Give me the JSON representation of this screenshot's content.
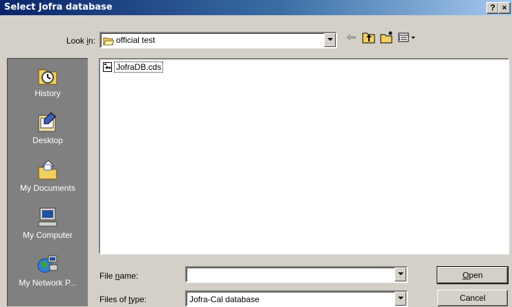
{
  "window": {
    "title": "Select Jofra database",
    "help_label": "?",
    "close_label": "×"
  },
  "lookin": {
    "label_pre": "Look ",
    "label_key": "i",
    "label_post": "n:",
    "value": "official test"
  },
  "toolbar": {
    "back_icon": "back-arrow-icon",
    "up_icon": "up-folder-icon",
    "new_folder_icon": "new-folder-icon",
    "view_icon": "view-menu-icon"
  },
  "places": [
    {
      "label": "History",
      "icon": "history-icon"
    },
    {
      "label": "Desktop",
      "icon": "desktop-icon"
    },
    {
      "label": "My Documents",
      "icon": "my-documents-icon"
    },
    {
      "label": "My Computer",
      "icon": "my-computer-icon"
    },
    {
      "label": "My Network P...",
      "icon": "network-places-icon"
    }
  ],
  "files": [
    {
      "name": "JofraDB.cds",
      "icon": "database-file-icon"
    }
  ],
  "filename": {
    "label_pre": "File ",
    "label_key": "n",
    "label_post": "ame:",
    "value": ""
  },
  "filetype": {
    "label_pre": "Files of ",
    "label_key": "t",
    "label_post": "ype:",
    "value": "Jofra-Cal database"
  },
  "buttons": {
    "open_key": "O",
    "open_rest": "pen",
    "cancel": "Cancel"
  }
}
